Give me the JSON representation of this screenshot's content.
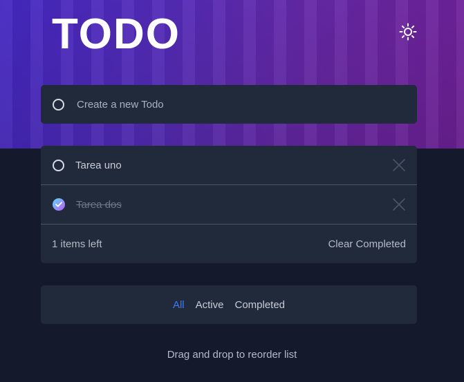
{
  "app": {
    "title": "TODO",
    "theme_icon": "sun-icon"
  },
  "create": {
    "placeholder": "Create a new Todo"
  },
  "todos": [
    {
      "label": "Tarea uno",
      "completed": false
    },
    {
      "label": "Tarea dos",
      "completed": true
    }
  ],
  "footer": {
    "items_left": "1 items left",
    "clear_label": "Clear Completed"
  },
  "filters": [
    {
      "label": "All",
      "active": true
    },
    {
      "label": "Active",
      "active": false
    },
    {
      "label": "Completed",
      "active": false
    }
  ],
  "hint": "Drag and drop to reorder list",
  "colors": {
    "accent": "#3a7bfd",
    "check_gradient_start": "#57ddff",
    "check_gradient_end": "#c058f3",
    "card_bg": "#202a3b",
    "page_bg": "#141a2b"
  }
}
